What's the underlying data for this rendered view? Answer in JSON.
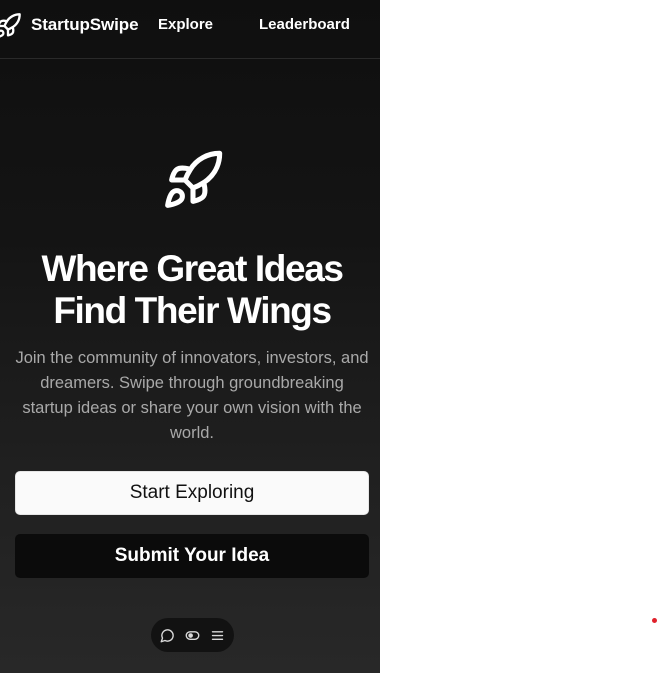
{
  "header": {
    "brand_icon": "rocket-icon",
    "brand_name": "StartupSwipe",
    "nav": {
      "explore": "Explore",
      "leaderboard": "Leaderboard"
    }
  },
  "hero": {
    "icon": "rocket-icon",
    "title_line1": "Where Great Ideas",
    "title_line2": "Find Their Wings",
    "subtitle": "Join the community of innovators, investors, and dreamers. Swipe through groundbreaking startup ideas or share your own vision with the world."
  },
  "actions": {
    "start_exploring": "Start Exploring",
    "submit_idea": "Submit Your Idea"
  },
  "dock": {
    "icons": [
      "chat-bubble-icon",
      "toggle-eye-icon",
      "menu-icon"
    ]
  },
  "colors": {
    "background_top": "#0f0f0f",
    "background_bottom": "#282828",
    "primary_button_bg": "#fafafa",
    "secondary_button_bg": "#0b0b0b",
    "subtitle_text": "#a9a9a9",
    "indicator_dot": "#e0212b"
  }
}
